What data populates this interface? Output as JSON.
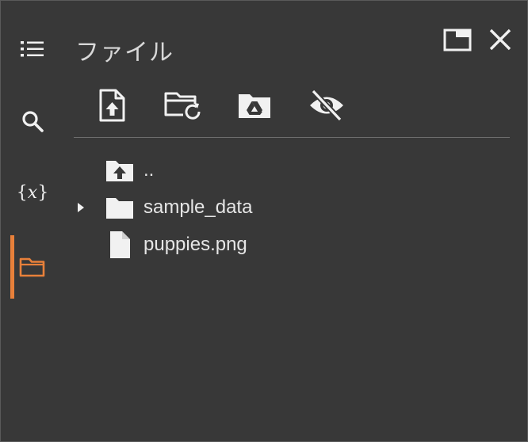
{
  "panel": {
    "title": "ファイル"
  },
  "rail": {
    "items": [
      {
        "name": "table-of-contents",
        "icon": "list-icon"
      },
      {
        "name": "search",
        "icon": "search-icon"
      },
      {
        "name": "variables",
        "icon": "variables-icon",
        "label_open": "{",
        "label_var": "x",
        "label_close": "}"
      },
      {
        "name": "files",
        "icon": "folder-icon",
        "active": true
      }
    ]
  },
  "toolbar": {
    "buttons": [
      {
        "name": "upload-file",
        "icon": "upload-file-icon"
      },
      {
        "name": "refresh",
        "icon": "folder-refresh-icon"
      },
      {
        "name": "mount-drive",
        "icon": "drive-folder-icon"
      },
      {
        "name": "toggle-hidden-files",
        "icon": "eye-off-icon"
      }
    ]
  },
  "tree": {
    "items": [
      {
        "label": "..",
        "icon": "folder-up-icon",
        "expandable": false
      },
      {
        "label": "sample_data",
        "icon": "folder-icon",
        "expandable": true
      },
      {
        "label": "puppies.png",
        "icon": "file-icon",
        "expandable": false
      }
    ]
  },
  "colors": {
    "background": "#383838",
    "accent": "#e8803a",
    "icon": "#f1f1f1",
    "text": "#e6e6e6",
    "divider": "#6e6e6e"
  }
}
